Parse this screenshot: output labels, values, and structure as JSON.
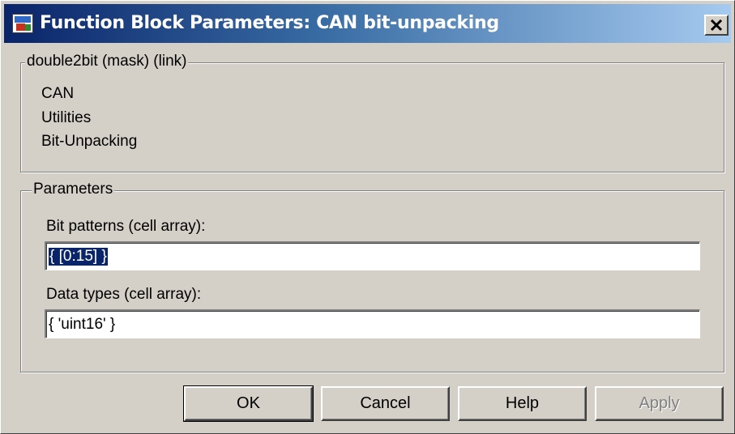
{
  "window": {
    "title": "Function Block Parameters: CAN bit-unpacking",
    "close_label": "X"
  },
  "description_group": {
    "legend": "double2bit (mask) (link)",
    "lines": [
      "CAN",
      "Utilities",
      "Bit-Unpacking"
    ]
  },
  "parameters_group": {
    "legend": "Parameters",
    "bit_patterns": {
      "label": "Bit patterns (cell array):",
      "value": "{ [0:15] }"
    },
    "data_types": {
      "label": "Data types (cell array):",
      "value": "{ 'uint16' }"
    }
  },
  "buttons": {
    "ok": "OK",
    "cancel": "Cancel",
    "help": "Help",
    "apply": "Apply"
  }
}
